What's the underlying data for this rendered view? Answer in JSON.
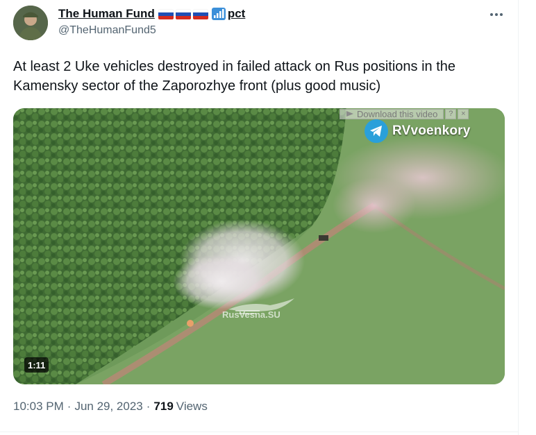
{
  "author": {
    "display_name": "The Human Fund",
    "name_suffix": "pct",
    "handle": "@TheHumanFund5",
    "flags": [
      "russia-flag",
      "russia-flag",
      "russia-flag"
    ],
    "signal_icon": "signal-bars-icon"
  },
  "tweet": {
    "text": "At least 2 Uke vehicles destroyed in failed attack on Rus positions in the Kamensky sector of the Zaporozhye front (plus good music)"
  },
  "video": {
    "download_label": "Download this video",
    "help_label": "?",
    "close_label": "×",
    "channel_name": "RVvoenkory",
    "watermark": "RusVesna.SU",
    "duration": "1:11"
  },
  "meta": {
    "time": "10:03 PM",
    "separator": "·",
    "date": "Jun 29, 2023",
    "views_count": "719",
    "views_label": "Views"
  },
  "colors": {
    "text_primary": "#0f1419",
    "text_secondary": "#536471",
    "telegram_blue": "#2aa0da",
    "divider": "#eff3f4"
  }
}
